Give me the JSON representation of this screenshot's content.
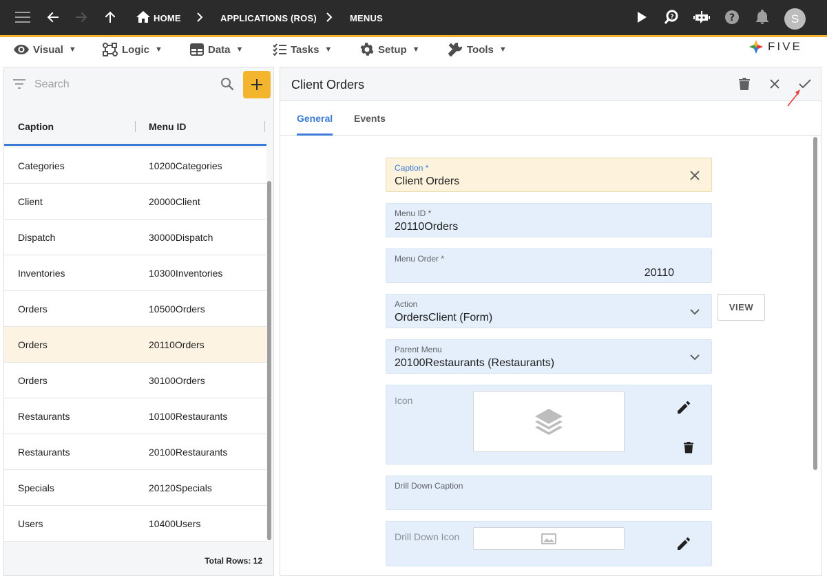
{
  "topbar": {
    "breadcrumbs": [
      "HOME",
      "APPLICATIONS (ROS)",
      "MENUS"
    ],
    "avatar_initial": "S",
    "icons": [
      "menu-icon",
      "back-arrow-icon",
      "forward-arrow-icon",
      "up-arrow-icon",
      "home-icon",
      "play-icon",
      "search-help-icon",
      "chat-bot-icon",
      "help-icon",
      "bell-icon"
    ]
  },
  "menubar": {
    "items": [
      {
        "label": "Visual",
        "icon": "eye-icon"
      },
      {
        "label": "Logic",
        "icon": "logic-icon"
      },
      {
        "label": "Data",
        "icon": "table-icon"
      },
      {
        "label": "Tasks",
        "icon": "tasks-icon"
      },
      {
        "label": "Setup",
        "icon": "gear-icon"
      },
      {
        "label": "Tools",
        "icon": "tools-icon"
      }
    ],
    "caret": "▼",
    "logo_text": "FIVE"
  },
  "leftpanel": {
    "search_placeholder": "Search",
    "columns": [
      "Caption",
      "Menu ID"
    ],
    "rows": [
      {
        "caption": "Categories",
        "menu_id": "10200Categories"
      },
      {
        "caption": "Client",
        "menu_id": "20000Client"
      },
      {
        "caption": "Dispatch",
        "menu_id": "30000Dispatch"
      },
      {
        "caption": "Inventories",
        "menu_id": "10300Inventories"
      },
      {
        "caption": "Orders",
        "menu_id": "10500Orders"
      },
      {
        "caption": "Orders",
        "menu_id": "20110Orders"
      },
      {
        "caption": "Orders",
        "menu_id": "30100Orders"
      },
      {
        "caption": "Restaurants",
        "menu_id": "10100Restaurants"
      },
      {
        "caption": "Restaurants",
        "menu_id": "20100Restaurants"
      },
      {
        "caption": "Specials",
        "menu_id": "20120Specials"
      },
      {
        "caption": "Users",
        "menu_id": "10400Users"
      }
    ],
    "selected_row_index": 5,
    "total_rows": "Total Rows: 12"
  },
  "form": {
    "title": "Client Orders",
    "tabs": [
      "General",
      "Events"
    ],
    "active_tab": "General",
    "fields": {
      "caption": {
        "label": "Caption *",
        "value": "Client Orders"
      },
      "menu_id": {
        "label": "Menu ID *",
        "value": "20110Orders"
      },
      "menu_order": {
        "label": "Menu Order *",
        "value": "20110"
      },
      "action": {
        "label": "Action",
        "value": "OrdersClient (Form)"
      },
      "parent_menu": {
        "label": "Parent Menu",
        "value": "20100Restaurants (Restaurants)"
      },
      "icon": {
        "label": "Icon"
      },
      "drill_down_caption": {
        "label": "Drill Down Caption",
        "value": ""
      },
      "drill_down_icon": {
        "label": "Drill Down Icon"
      }
    },
    "view_button": "VIEW"
  },
  "colors": {
    "topbar_bg": "#2b2b2b",
    "accent": "#f3b52d",
    "primary": "#3a7bd5",
    "field_bg": "#e4effb",
    "focused_field_bg": "#fdf3dc",
    "selected_row_bg": "#fdf3e3",
    "annotation": "#e53935"
  }
}
